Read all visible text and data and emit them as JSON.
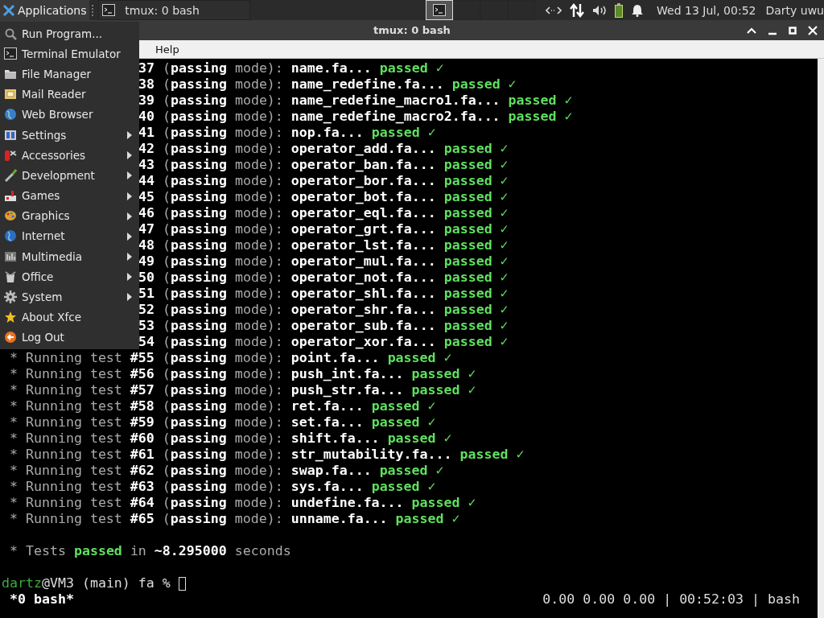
{
  "panel": {
    "apps_button": "Applications",
    "task": {
      "title": "tmux: 0 bash",
      "selected": false
    },
    "workspaces": [
      {
        "selected": true
      },
      {
        "selected": false
      },
      {
        "selected": false
      },
      {
        "selected": false
      }
    ],
    "clock": "Wed 13 Jul, 00:52",
    "user": "Darty uwu"
  },
  "window": {
    "title": "tmux: 0 bash",
    "menubar": [
      "Help"
    ]
  },
  "app_menu": [
    {
      "label": "Run Program...",
      "submenu": false
    },
    {
      "label": "Terminal Emulator",
      "submenu": false
    },
    {
      "label": "File Manager",
      "submenu": false
    },
    {
      "label": "Mail Reader",
      "submenu": false
    },
    {
      "label": "Web Browser",
      "submenu": false
    },
    {
      "label": "Settings",
      "submenu": true
    },
    {
      "label": "Accessories",
      "submenu": true
    },
    {
      "label": "Development",
      "submenu": true
    },
    {
      "label": "Games",
      "submenu": true
    },
    {
      "label": "Graphics",
      "submenu": true
    },
    {
      "label": "Internet",
      "submenu": true
    },
    {
      "label": "Multimedia",
      "submenu": true
    },
    {
      "label": "Office",
      "submenu": true
    },
    {
      "label": "System",
      "submenu": true
    },
    {
      "label": "About Xfce",
      "submenu": false
    },
    {
      "label": "Log Out",
      "submenu": false
    }
  ],
  "terminal": {
    "lines": [
      {
        "test": "37",
        "mode": "(**passing** mode):",
        "file": "name.fa",
        "dots": "...",
        "result": "passed ✓"
      },
      {
        "test": "38",
        "mode": "(**passing** mode):",
        "file": "name_redefine.fa",
        "dots": "...",
        "result": "passed ✓"
      },
      {
        "test": "39",
        "mode": "(**passing** mode):",
        "file": "name_redefine_macro1.fa",
        "dots": "...",
        "result": "passed ✓"
      },
      {
        "test": "40",
        "mode": "(**passing** mode):",
        "file": "name_redefine_macro2.fa",
        "dots": "...",
        "result": "passed ✓"
      },
      {
        "test": "41",
        "mode": "(**passing** mode):",
        "file": "nop.fa",
        "dots": "...",
        "result": "passed ✓"
      },
      {
        "test": "42",
        "mode": "(**passing** mode):",
        "file": "operator_add.fa",
        "dots": "...",
        "result": "passed ✓"
      },
      {
        "test": "43",
        "mode": "(**passing** mode):",
        "file": "operator_ban.fa",
        "dots": "...",
        "result": "passed ✓"
      },
      {
        "test": "44",
        "mode": "(**passing** mode):",
        "file": "operator_bor.fa",
        "dots": "...",
        "result": "passed ✓"
      },
      {
        "test": "45",
        "mode": "(**passing** mode):",
        "file": "operator_bot.fa",
        "dots": "...",
        "result": "passed ✓"
      },
      {
        "test": "46",
        "mode": "(**passing** mode):",
        "file": "operator_eql.fa",
        "dots": "...",
        "result": "passed ✓"
      },
      {
        "test": "47",
        "mode": "(**passing** mode):",
        "file": "operator_grt.fa",
        "dots": "...",
        "result": "passed ✓"
      },
      {
        "test": "48",
        "mode": "(**passing** mode):",
        "file": "operator_lst.fa",
        "dots": "...",
        "result": "passed ✓"
      },
      {
        "test": "49",
        "mode": "(**passing** mode):",
        "file": "operator_mul.fa",
        "dots": "...",
        "result": "passed ✓"
      },
      {
        "test": "50",
        "mode": "(**passing** mode):",
        "file": "operator_not.fa",
        "dots": "...",
        "result": "passed ✓"
      },
      {
        "test": "51",
        "mode": "(**passing** mode):",
        "file": "operator_shl.fa",
        "dots": "...",
        "result": "passed ✓"
      },
      {
        "test": "52",
        "mode": "(**passing** mode):",
        "file": "operator_shr.fa",
        "dots": "...",
        "result": "passed ✓"
      },
      {
        "test": "53",
        "mode": "(**passing** mode):",
        "file": "operator_sub.fa",
        "dots": "...",
        "result": "passed ✓"
      },
      {
        "test": "54",
        "mode": "(**passing** mode):",
        "file": "operator_xor.fa",
        "dots": "...",
        "result": "passed ✓"
      },
      {
        "lead": "* Running test",
        "test": "#55",
        "mode": "(**passing** mode):",
        "file": "point.fa",
        "dots": "...",
        "result": "passed ✓"
      },
      {
        "lead": "* Running test",
        "test": "#56",
        "mode": "(**passing** mode):",
        "file": "push_int.fa",
        "dots": "...",
        "result": "passed ✓"
      },
      {
        "lead": "* Running test",
        "test": "#57",
        "mode": "(**passing** mode):",
        "file": "push_str.fa",
        "dots": "...",
        "result": "passed ✓"
      },
      {
        "lead": "* Running test",
        "test": "#58",
        "mode": "(**passing** mode):",
        "file": "ret.fa",
        "dots": "...",
        "result": "passed ✓"
      },
      {
        "lead": "* Running test",
        "test": "#59",
        "mode": "(**passing** mode):",
        "file": "set.fa",
        "dots": "...",
        "result": "passed ✓"
      },
      {
        "lead": "* Running test",
        "test": "#60",
        "mode": "(**passing** mode):",
        "file": "shift.fa",
        "dots": "...",
        "result": "passed ✓"
      },
      {
        "lead": "* Running test",
        "test": "#61",
        "mode": "(**passing** mode):",
        "file": "str_mutability.fa",
        "dots": "...",
        "result": "passed ✓"
      },
      {
        "lead": "* Running test",
        "test": "#62",
        "mode": "(**passing** mode):",
        "file": "swap.fa",
        "dots": "...",
        "result": "passed ✓"
      },
      {
        "lead": "* Running test",
        "test": "#63",
        "mode": "(**passing** mode):",
        "file": "sys.fa",
        "dots": "...",
        "result": "passed ✓"
      },
      {
        "lead": "* Running test",
        "test": "#64",
        "mode": "(**passing** mode):",
        "file": "undefine.fa",
        "dots": "...",
        "result": "passed ✓"
      },
      {
        "lead": "* Running test",
        "test": "#65",
        "mode": "(**passing** mode):",
        "file": "unname.fa",
        "dots": "...",
        "result": "passed ✓"
      }
    ],
    "summary": {
      "lead": "* Tests",
      "passed": "passed",
      "middle": "in",
      "time": "~8.295000",
      "tail": "seconds"
    },
    "prompt": {
      "user": "dartz",
      "rest": "@VM3 (main) fa %"
    },
    "status_bar": {
      "session": "*0 bash*",
      "right": "0.00 0.00 0.00 | 00:52:03 | bash"
    }
  }
}
